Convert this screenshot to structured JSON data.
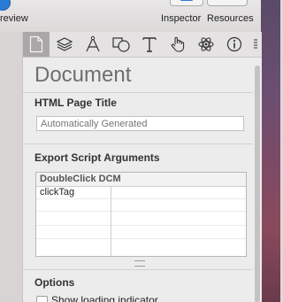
{
  "toolbar": {
    "preview_label": "review",
    "inspector_label": "Inspector",
    "resources_label": "Resources"
  },
  "tabs": [
    {
      "icon": "document-icon",
      "active": true
    },
    {
      "icon": "layers-icon"
    },
    {
      "icon": "drawing-tools-icon"
    },
    {
      "icon": "shapes-icon"
    },
    {
      "icon": "text-icon"
    },
    {
      "icon": "hand-icon"
    },
    {
      "icon": "atom-icon"
    },
    {
      "icon": "info-icon"
    },
    {
      "icon": "more-icon"
    }
  ],
  "document": {
    "title": "Document",
    "html_title_heading": "HTML Page Title",
    "html_title_placeholder": "Automatically Generated",
    "export_heading": "Export Script Arguments",
    "export_table": {
      "header": "DoubleClick DCM",
      "rows": [
        {
          "key": "clickTag",
          "value": ""
        },
        {
          "key": "",
          "value": ""
        },
        {
          "key": "",
          "value": ""
        },
        {
          "key": "",
          "value": ""
        },
        {
          "key": "",
          "value": ""
        }
      ]
    },
    "options_heading": "Options",
    "show_loading_label": "Show loading indicator"
  },
  "colors": {
    "accent": "#2a7bd6",
    "active_tab": "#a9a7a7"
  }
}
